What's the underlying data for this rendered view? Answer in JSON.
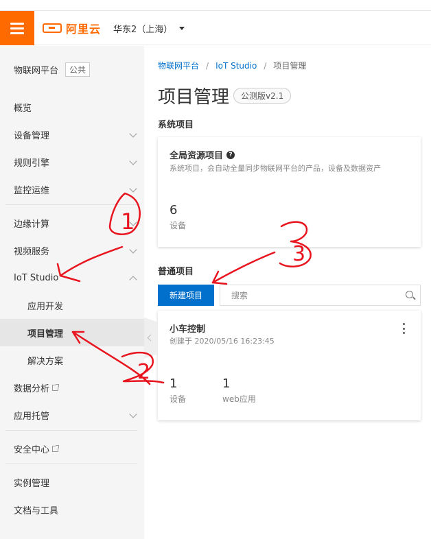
{
  "header": {
    "logo_text": "阿里云",
    "region": "华东2（上海）"
  },
  "sidebar": {
    "title": "物联网平台",
    "badge": "公共",
    "items": [
      {
        "label": "概览"
      },
      {
        "label": "设备管理"
      },
      {
        "label": "规则引擎"
      },
      {
        "label": "监控运维"
      },
      {
        "label": "边缘计算"
      },
      {
        "label": "视频服务"
      },
      {
        "label": "IoT Studio"
      },
      {
        "label": "应用开发"
      },
      {
        "label": "项目管理"
      },
      {
        "label": "解决方案"
      },
      {
        "label": "数据分析"
      },
      {
        "label": "应用托管"
      },
      {
        "label": "安全中心"
      },
      {
        "label": "实例管理"
      },
      {
        "label": "文档与工具"
      }
    ]
  },
  "breadcrumb": {
    "items": [
      "物联网平台",
      "IoT Studio",
      "项目管理"
    ],
    "separator": "/"
  },
  "page": {
    "title": "项目管理",
    "version_badge": "公测版v2.1"
  },
  "system_projects": {
    "label": "系统项目",
    "card": {
      "title": "全局资源项目",
      "help": "?",
      "description": "系统项目，会自动全量同步物联网平台的产品，设备及数据资产",
      "device_count": "6",
      "device_label": "设备"
    }
  },
  "normal_projects": {
    "label": "普通项目",
    "new_button": "新建项目",
    "search_placeholder": "搜索",
    "card": {
      "title": "小车控制",
      "created": "创建于 2020/05/16 16:23:45",
      "device_count": "1",
      "device_label": "设备",
      "web_count": "1",
      "web_label": "web应用"
    }
  },
  "annotations": {
    "numbers": [
      "1",
      "2",
      "3"
    ],
    "color": "#e8141e"
  },
  "colors": {
    "brand": "#ff6a00",
    "primary": "#0070cc"
  }
}
